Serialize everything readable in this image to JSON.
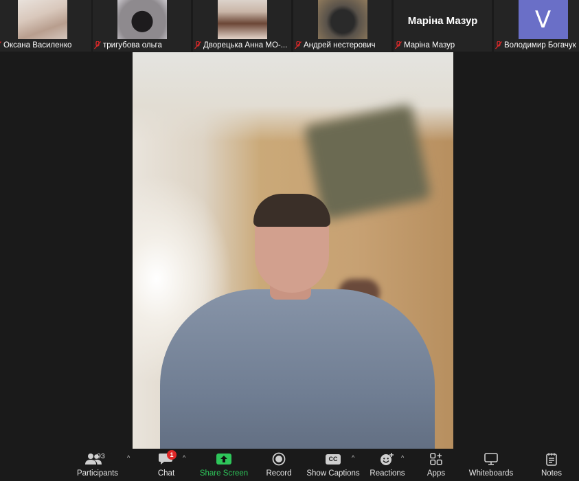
{
  "participants_strip": [
    {
      "name": "Оксана Василенко",
      "muted": false
    },
    {
      "name": "тригубова ольга",
      "muted": true
    },
    {
      "name": "Дворецька Анна МО-...",
      "muted": true
    },
    {
      "name": "Андрей нестерович",
      "muted": true
    },
    {
      "name": "Маріна Мазур",
      "muted": true,
      "display_name": "Маріна Мазур"
    },
    {
      "name": "Володимир Богачук",
      "muted": true,
      "avatar_letter": "V",
      "avatar_color": "#6a6fc7"
    }
  ],
  "toolbar": {
    "participants": {
      "label": "Participants",
      "count": "93",
      "icon": "participants-icon"
    },
    "chat": {
      "label": "Chat",
      "badge": "1",
      "icon": "chat-icon"
    },
    "share_screen": {
      "label": "Share Screen",
      "icon": "share-screen-icon",
      "color": "#2ec65a"
    },
    "record": {
      "label": "Record",
      "icon": "record-icon"
    },
    "captions": {
      "label": "Show Captions",
      "icon": "cc-icon",
      "icon_text": "CC"
    },
    "reactions": {
      "label": "Reactions",
      "icon": "reactions-icon"
    },
    "apps": {
      "label": "Apps",
      "icon": "apps-icon"
    },
    "whiteboards": {
      "label": "Whiteboards",
      "icon": "whiteboard-icon"
    },
    "notes": {
      "label": "Notes",
      "icon": "notes-icon"
    }
  },
  "colors": {
    "background": "#1a1a1a",
    "tile": "#242424",
    "mute_red": "#e02828",
    "share_green": "#2ec65a"
  }
}
